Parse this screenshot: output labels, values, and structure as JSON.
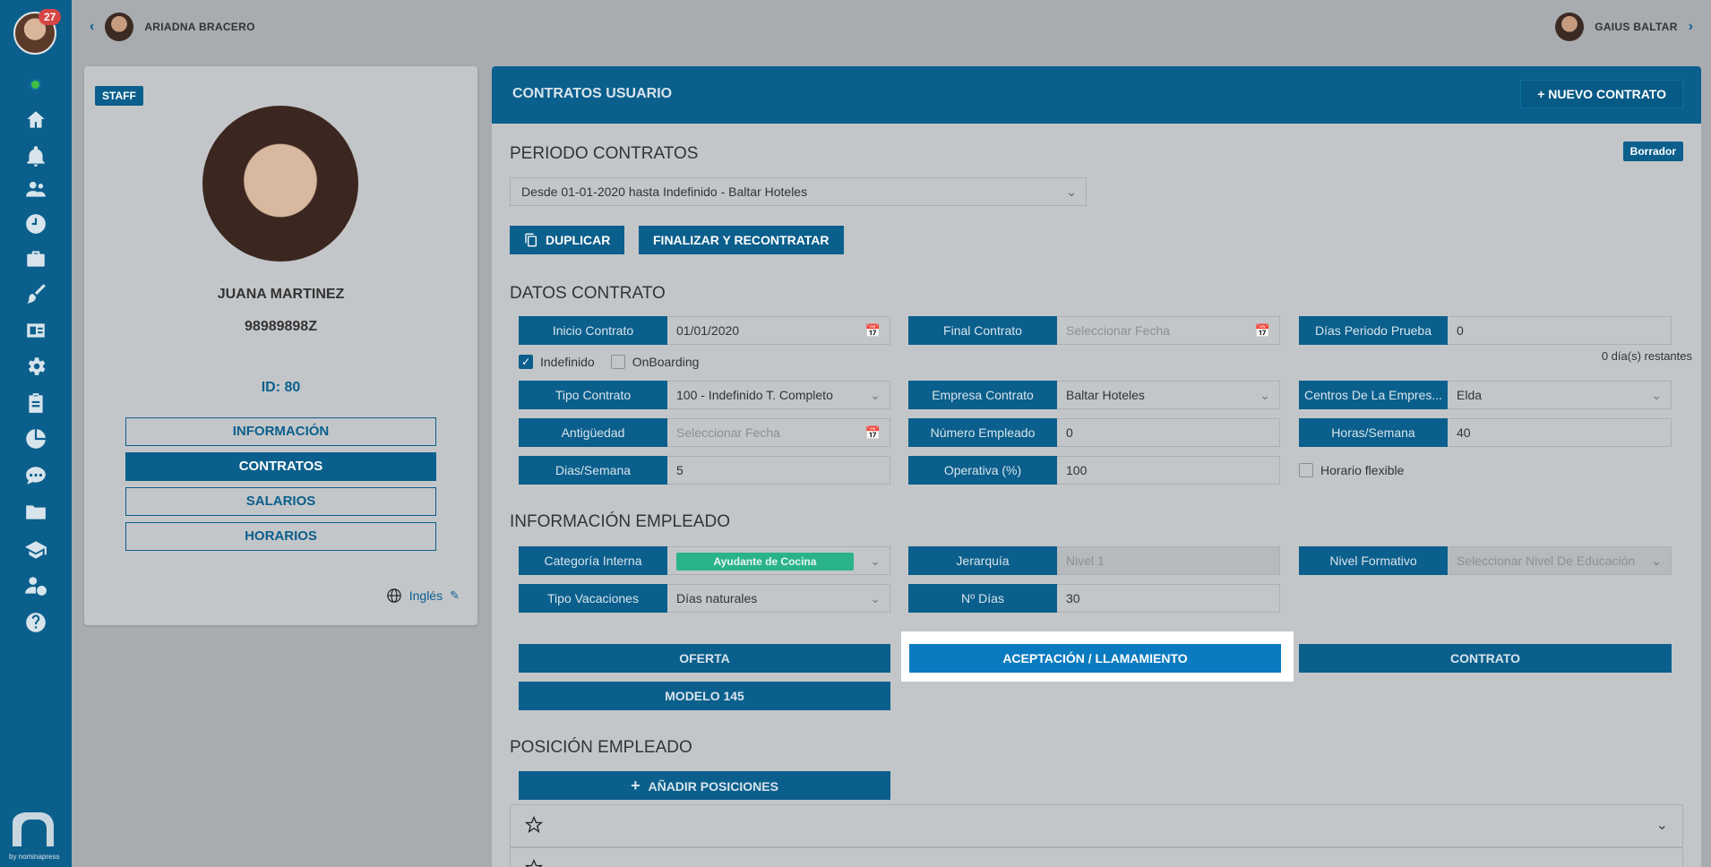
{
  "sidebar": {
    "notification_count": "27",
    "icons": [
      "home-icon",
      "bell-icon",
      "users-icon",
      "clock-icon",
      "briefcase-icon",
      "brush-icon",
      "id-card-icon",
      "gear-icon",
      "clipboard-icon",
      "pie-chart-icon",
      "chat-icon",
      "folder-icon",
      "graduation-icon",
      "user-money-icon",
      "help-icon"
    ],
    "brand_text": "by nominapress"
  },
  "topbar": {
    "left_name": "ARIADNA BRACERO",
    "right_name": "GAIUS BALTAR"
  },
  "profile": {
    "badge": "STAFF",
    "name": "JUANA MARTINEZ",
    "document": "98989898Z",
    "id_label": "ID: 80",
    "buttons": [
      "INFORMACIÓN",
      "CONTRATOS",
      "SALARIOS",
      "HORARIOS"
    ],
    "active_button": "CONTRATOS",
    "language": "Inglés"
  },
  "main": {
    "title": "CONTRATOS USUARIO",
    "new_button": "NUEVO CONTRATO",
    "period_title": "PERIODO CONTRATOS",
    "draft_badge": "Borrador",
    "period_value": "Desde 01-01-2020 hasta Indefinido - Baltar Hoteles",
    "duplicate_button": "DUPLICAR",
    "finalize_button": "FINALIZAR Y RECONTRATAR",
    "contract_title": "DATOS CONTRATO",
    "fields": {
      "inicio_label": "Inicio Contrato",
      "inicio_value": "01/01/2020",
      "final_label": "Final Contrato",
      "final_placeholder": "Seleccionar Fecha",
      "prueba_label": "Días Periodo Prueba",
      "prueba_value": "0",
      "remaining": "0 día(s) restantes",
      "indefinido": "Indefinido",
      "onboarding": "OnBoarding",
      "tipo_label": "Tipo Contrato",
      "tipo_value": "100 - Indefinido T. Completo",
      "empresa_label": "Empresa Contrato",
      "empresa_value": "Baltar Hoteles",
      "centros_label": "Centros De La Empres...",
      "centros_value": "Elda",
      "antiguedad_label": "Antigüedad",
      "antiguedad_placeholder": "Seleccionar Fecha",
      "numero_label": "Número Empleado",
      "numero_value": "0",
      "horas_label": "Horas/Semana",
      "horas_value": "40",
      "dias_label": "Dias/Semana",
      "dias_value": "5",
      "operativa_label": "Operativa (%)",
      "operativa_value": "100",
      "horario_flexible": "Horario flexible"
    },
    "employee_title": "INFORMACIÓN EMPLEADO",
    "employee": {
      "categoria_label": "Categoría Interna",
      "categoria_value": "Ayudante de Cocina",
      "jerarquia_label": "Jerarquía",
      "jerarquia_value": "Nivel 1",
      "nivel_label": "Nivel Formativo",
      "nivel_placeholder": "Seleccionar Nivel De Educación",
      "vacaciones_label": "Tipo Vacaciones",
      "vacaciones_value": "Días naturales",
      "ndias_label": "Nº Días",
      "ndias_value": "30"
    },
    "doc_buttons": {
      "oferta": "OFERTA",
      "aceptacion": "ACEPTACIÓN / LLAMAMIENTO",
      "contrato": "CONTRATO",
      "modelo": "MODELO 145"
    },
    "position_title": "POSICIÓN EMPLEADO",
    "add_positions": "AÑADIR POSICIONES"
  },
  "colors": {
    "primary": "#0b5f8c",
    "highlight": "#0a7bc0",
    "chip": "#2ab38a",
    "badge": "#d64545"
  }
}
